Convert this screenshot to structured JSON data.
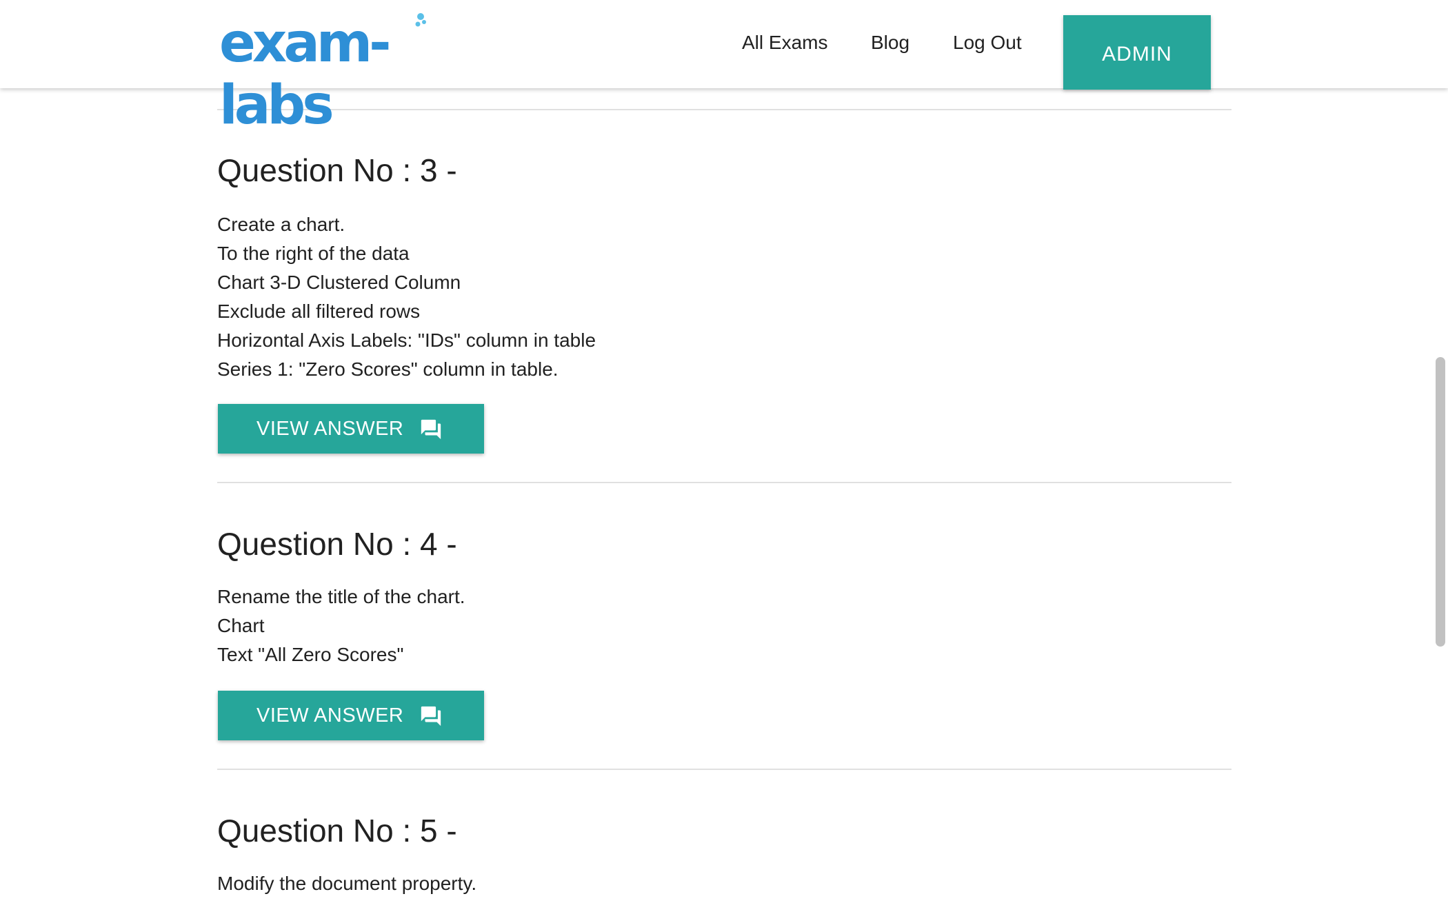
{
  "header": {
    "logo_text": "exam-labs",
    "nav": [
      {
        "label": "All Exams"
      },
      {
        "label": "Blog"
      },
      {
        "label": "Log Out"
      }
    ],
    "admin_label": "ADMIN"
  },
  "colors": {
    "accent": "#26a69a",
    "logo_blue": "#2e8fd6",
    "logo_bubble": "#5bc0e8",
    "divider": "#e0e0e0",
    "text": "#212121"
  },
  "questions": [
    {
      "title": "Question No : 3 -",
      "lines": [
        "Create a chart.",
        "To the right of the data",
        "Chart 3-D Clustered Column",
        "Exclude all filtered rows",
        "Horizontal Axis Labels: \"IDs\" column in table",
        "Series 1: \"Zero Scores\" column in table."
      ],
      "button_label": "VIEW ANSWER",
      "button_icon": "forum-icon"
    },
    {
      "title": "Question No : 4 -",
      "lines": [
        "Rename the title of the chart.",
        "Chart",
        "Text \"All Zero Scores\""
      ],
      "button_label": "VIEW ANSWER",
      "button_icon": "forum-icon"
    },
    {
      "title": "Question No : 5 -",
      "lines": [
        "Modify the document property."
      ]
    }
  ]
}
